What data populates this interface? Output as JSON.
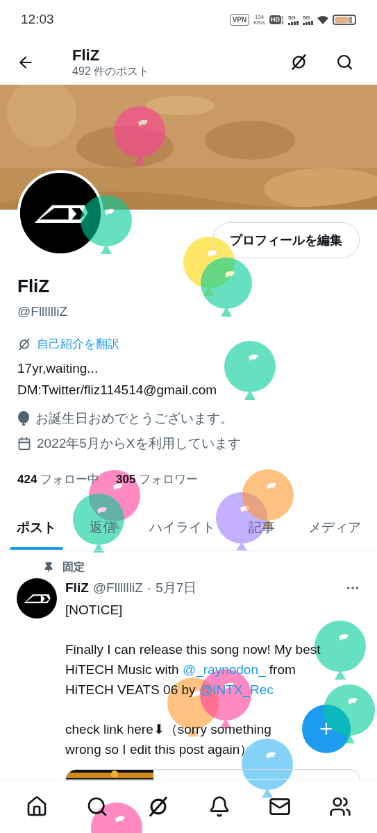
{
  "status_bar": {
    "time": "12:03",
    "vpn": "VPN",
    "speed": "134",
    "speed_unit": "KB/s",
    "hd": "HD",
    "hd_sims": [
      "1",
      "2"
    ],
    "networks": [
      "5G",
      "5G"
    ]
  },
  "header": {
    "title": "FliZ",
    "subtitle": "492 件のポスト"
  },
  "profile": {
    "edit_button": "プロフィールを編集",
    "name": "FliZ",
    "handle": "@FlllllliZ",
    "translate": "自己紹介を翻訳",
    "bio": "17yr,waiting...\nDM:Twitter/fliz114514@gmail.com",
    "birthday": "お誕生日おめでとうございます。",
    "joined": "2022年5月からXを利用しています",
    "following_count": "424",
    "following_label": "フォロー中",
    "followers_count": "305",
    "followers_label": "フォロワー"
  },
  "tabs": [
    {
      "label": "ポスト",
      "selected": true
    },
    {
      "label": "返信",
      "selected": false
    },
    {
      "label": "ハイライト",
      "selected": false
    },
    {
      "label": "記事",
      "selected": false
    },
    {
      "label": "メディア",
      "selected": false
    }
  ],
  "post": {
    "pinned_label": "固定",
    "name": "FliZ",
    "handle": "@FlllllliZ",
    "separator": "·",
    "date": "5月7日",
    "paragraphs": [
      [
        {
          "kind": "text",
          "text": "[NOTICE]"
        }
      ],
      [
        {
          "kind": "text",
          "text": "Finally I can release this song now! My best HiTECH Music with "
        },
        {
          "kind": "link",
          "text": "@_raynodon_"
        },
        {
          "kind": "text",
          "text": " from HiTECH VEATS 06 by "
        },
        {
          "kind": "link",
          "text": "@INTX_Rec"
        }
      ],
      [
        {
          "kind": "text",
          "text": "check link here⬇（sorry something wrong so I edit this post again）"
        }
      ]
    ]
  }
}
